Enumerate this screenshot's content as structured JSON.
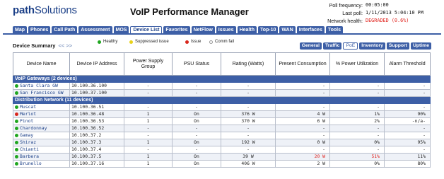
{
  "brand": {
    "name_bold": "path",
    "name_rest": "Solutions"
  },
  "app_title": "VoIP Performance Manager",
  "status": {
    "poll_frequency_label": "Poll frequency:",
    "poll_frequency": "00:05:00",
    "last_poll_label": "Last poll:",
    "last_poll": "1/11/2013 5:04:10 PM",
    "network_health_label": "Network health:",
    "network_health": "DEGRADED (0.6%)"
  },
  "tabs": [
    "Map",
    "Phones",
    "Call Path",
    "Assessment",
    "MOS",
    "Device List",
    "Favorites",
    "NetFlow",
    "Issues",
    "Health",
    "Top-10",
    "WAN",
    "Interfaces",
    "Tools"
  ],
  "active_tab": "Device List",
  "summary": {
    "title": "Device Summary",
    "nav": "<< >>"
  },
  "legend": [
    {
      "label": "Healthy",
      "color": "#1fa61f"
    },
    {
      "label": "Suppressed issue",
      "color": "#e8d21a"
    },
    {
      "label": "Issue",
      "color": "#d8261c"
    },
    {
      "label": "Comm fail",
      "color": "#ffffff"
    }
  ],
  "subtabs": [
    "General",
    "Traffic",
    "PoE",
    "Inventory",
    "Support",
    "Uptime"
  ],
  "active_subtab": "PoE",
  "columns": [
    "Device Name",
    "Device IP Address",
    "Power Supply Group",
    "PSU Status",
    "Rating (Watts)",
    "Present Consumption",
    "% Power Utilization",
    "Alarm Threshold"
  ],
  "groups": [
    {
      "title": "VoIP Gateways (2 devices)",
      "rows": [
        {
          "status": "healthy",
          "name": "Santa Clara GW",
          "ip": "10.100.36.100",
          "group": "-",
          "psu": "-",
          "rating": "-",
          "consumption": "-",
          "util": "-",
          "threshold": "-",
          "alarm": false
        },
        {
          "status": "healthy",
          "name": "San Francisco GW",
          "ip": "10.100.37.100",
          "group": "-",
          "psu": "-",
          "rating": "-",
          "consumption": "-",
          "util": "-",
          "threshold": "-",
          "alarm": false
        }
      ]
    },
    {
      "title": "Distribution Network (11 devices)",
      "rows": [
        {
          "status": "healthy",
          "name": "Muscat",
          "ip": "10.100.36.51",
          "group": "-",
          "psu": "-",
          "rating": "-",
          "consumption": "-",
          "util": "-",
          "threshold": "-",
          "alarm": false
        },
        {
          "status": "issue",
          "name": "Merlot",
          "ip": "10.100.36.48",
          "group": "1",
          "psu": "On",
          "rating": "376 W",
          "consumption": "4 W",
          "util": "1%",
          "threshold": "90%",
          "alarm": false
        },
        {
          "status": "healthy",
          "name": "Pinot",
          "ip": "10.100.36.53",
          "group": "1",
          "psu": "On",
          "rating": "370 W",
          "consumption": "6 W",
          "util": "2%",
          "threshold": "-n/a-",
          "alarm": false
        },
        {
          "status": "healthy",
          "name": "Chardonnay",
          "ip": "10.100.36.52",
          "group": "-",
          "psu": "-",
          "rating": "-",
          "consumption": "-",
          "util": "-",
          "threshold": "-",
          "alarm": false
        },
        {
          "status": "healthy",
          "name": "Gamay",
          "ip": "10.100.37.2",
          "group": "-",
          "psu": "-",
          "rating": "-",
          "consumption": "-",
          "util": "-",
          "threshold": "-",
          "alarm": false
        },
        {
          "status": "healthy",
          "name": "Shiraz",
          "ip": "10.100.37.3",
          "group": "1",
          "psu": "On",
          "rating": "192 W",
          "consumption": "0 W",
          "util": "0%",
          "threshold": "95%",
          "alarm": false
        },
        {
          "status": "healthy",
          "name": "Chianti",
          "ip": "10.100.37.4",
          "group": "-",
          "psu": "-",
          "rating": "-",
          "consumption": "-",
          "util": "-",
          "threshold": "-",
          "alarm": false
        },
        {
          "status": "healthy",
          "name": "Barbera",
          "ip": "10.100.37.5",
          "group": "1",
          "psu": "On",
          "rating": "39 W",
          "consumption": "20 W",
          "util": "51%",
          "threshold": "11%",
          "alarm": true
        },
        {
          "status": "healthy",
          "name": "Brunello",
          "ip": "10.100.37.16",
          "group": "1",
          "psu": "On",
          "rating": "406 W",
          "consumption": "2 W",
          "util": "0%",
          "threshold": "80%",
          "alarm": false
        }
      ]
    }
  ]
}
